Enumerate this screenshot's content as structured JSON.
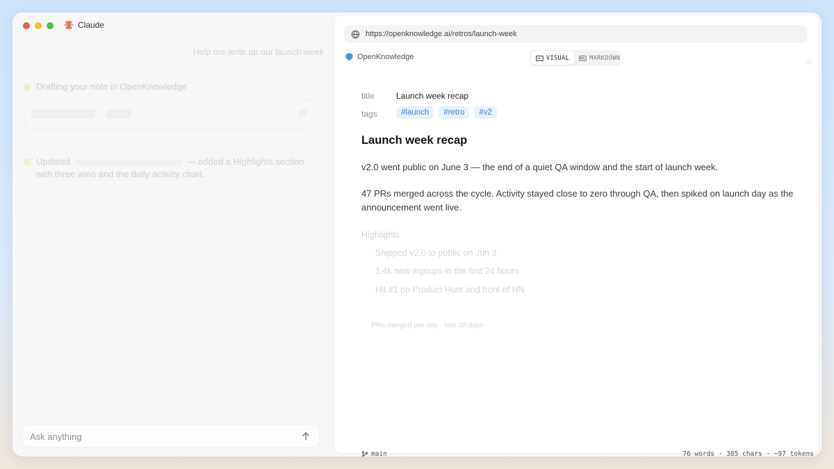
{
  "app": {
    "title": "Claude"
  },
  "colors": {
    "red": "#ee5a52",
    "yellow": "#f5bd2e",
    "green": "#4fc43f",
    "accent": "#d97757",
    "tag_blue": "#3b7ed6"
  },
  "chat": {
    "user_message": "Help me write up our launch week",
    "status_line": "Drafting your note in OpenKnowledge",
    "updated_text": "Updated",
    "updated_suffix": "— added a Highlights section with three wins and the daily activity chart.",
    "input_placeholder": "Ask anything"
  },
  "browser": {
    "url": "https://openknowledge.ai/retros/launch-week"
  },
  "site": {
    "name": "OpenKnowledge"
  },
  "view_toggle": {
    "visual_label": "VISUAL",
    "markdown_label": "MARKDOWN",
    "active": "visual"
  },
  "doc": {
    "meta": {
      "title_key": "title",
      "title_value": "Launch week recap",
      "tags_key": "tags",
      "tags": [
        "#launch",
        "#retro",
        "#v2"
      ]
    },
    "heading": "Launch week recap",
    "paragraphs": [
      "v2.0 went public on June 3 — the end of a quiet QA window and the start of launch week.",
      "47 PRs merged across the cycle. Activity stayed close to zero through QA, then spiked on launch day as the announcement went live."
    ],
    "highlights_heading": "Highlights",
    "highlights": [
      "Shipped v2.0 to public on Jun 3",
      "1.4k new signups in the first 24 hours",
      "Hit #1 on Product Hunt and front of HN"
    ],
    "chart_caption": "PRs merged per day · last 30 days"
  },
  "footer": {
    "branch": "main",
    "stats": "76 words · 385 chars · ~97 tokens"
  }
}
